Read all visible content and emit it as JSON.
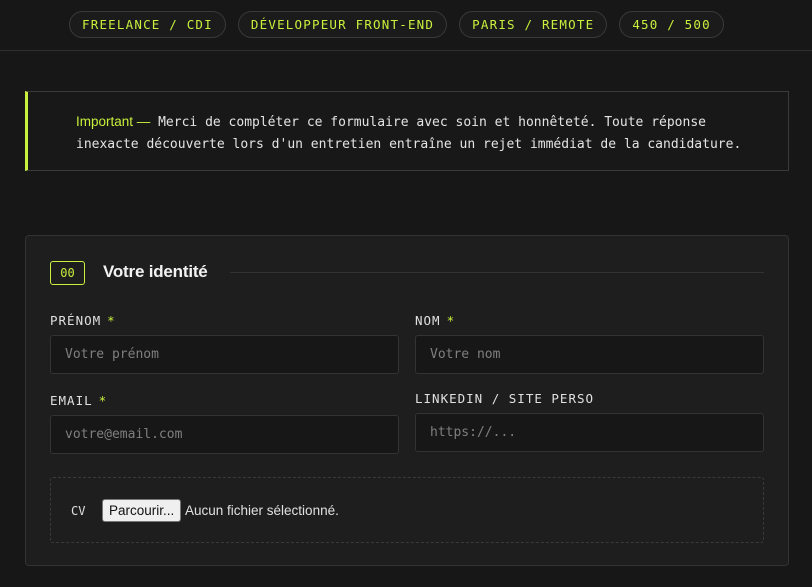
{
  "header": {
    "tags": [
      "FREELANCE / CDI",
      "DÉVELOPPEUR FRONT-END",
      "PARIS / REMOTE",
      "450 / 500"
    ]
  },
  "notice": {
    "label": "Important —",
    "text_line1": " Merci de compléter ce formulaire avec soin et honnêteté. Toute réponse",
    "text_line2": "inexacte découverte lors d'un entretien entraîne un rejet immédiat de la candidature."
  },
  "section": {
    "number": "00",
    "title": "Votre identité",
    "fields": {
      "first_name": {
        "label": "PRÉNOM",
        "placeholder": "Votre prénom",
        "value": "",
        "required_mark": "*"
      },
      "last_name": {
        "label": "NOM",
        "placeholder": "Votre nom",
        "value": "",
        "required_mark": "*"
      },
      "email": {
        "label": "EMAIL",
        "placeholder": "votre@email.com",
        "value": "",
        "required_mark": "*"
      },
      "website": {
        "label": "LINKEDIN / SITE PERSO",
        "placeholder": "https://...",
        "value": ""
      }
    },
    "cv": {
      "label": "CV",
      "button_label": "Parcourir...",
      "status": "Aucun fichier sélectionné."
    }
  },
  "colors": {
    "accent": "#c8f03c",
    "background": "#171717",
    "card": "#1e1e1e"
  }
}
